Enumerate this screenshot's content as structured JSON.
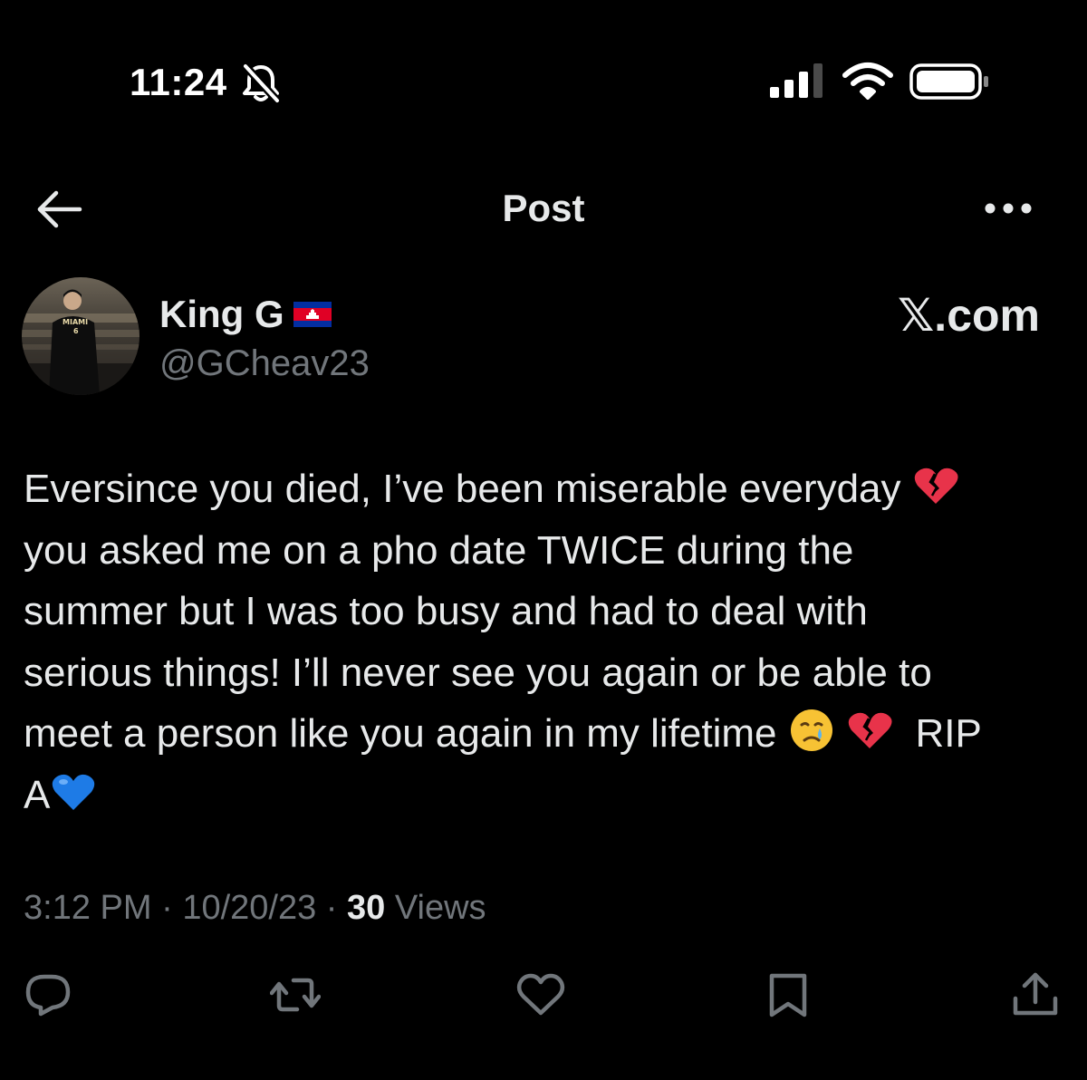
{
  "status_bar": {
    "time": "11:24",
    "icons": [
      "bell-muted-icon",
      "cellular-signal-icon",
      "wifi-icon",
      "battery-icon"
    ]
  },
  "header": {
    "title": "Post",
    "back_icon": "arrow-left-icon",
    "more_icon": "more-horizontal-icon"
  },
  "author": {
    "display_name": "King G",
    "flag": "cambodia-flag-icon",
    "handle": "@GCheav23",
    "avatar_icon": "avatar-photo"
  },
  "watermark": "𝕏.com",
  "post": {
    "lines": [
      "Eversince you died, I’ve been miserable everyday",
      "you asked me on a pho date TWICE during the",
      "summer but I was too busy and had to deal with",
      "serious things! I’ll never see you again or be able to",
      "meet a person like you again in my lifetime",
      "RIP",
      "A"
    ],
    "emojis": [
      "broken-heart",
      "crying-face",
      "broken-heart",
      "blue-heart"
    ]
  },
  "meta": {
    "time": "3:12 PM",
    "separator": "·",
    "date": "10/20/23",
    "views_count": "30",
    "views_label": "Views"
  },
  "actions": [
    {
      "name": "reply",
      "icon": "reply-icon"
    },
    {
      "name": "repost",
      "icon": "repost-icon"
    },
    {
      "name": "like",
      "icon": "heart-icon"
    },
    {
      "name": "bookmark",
      "icon": "bookmark-icon"
    },
    {
      "name": "share",
      "icon": "share-icon"
    }
  ],
  "colors": {
    "background": "#000000",
    "text_primary": "#e7e9ea",
    "text_secondary": "#71767b"
  }
}
